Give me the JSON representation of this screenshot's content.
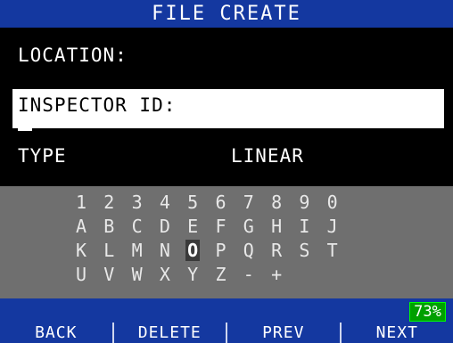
{
  "header": {
    "title": "FILE CREATE"
  },
  "fields": {
    "location_label": "LOCATION:",
    "inspector_label": "INSPECTOR ID:",
    "type_label": "TYPE",
    "type_value": "LINEAR"
  },
  "keyboard": {
    "rows": [
      [
        "1",
        "2",
        "3",
        "4",
        "5",
        "6",
        "7",
        "8",
        "9",
        "0"
      ],
      [
        "A",
        "B",
        "C",
        "D",
        "E",
        "F",
        "G",
        "H",
        "I",
        "J"
      ],
      [
        "K",
        "L",
        "M",
        "N",
        "O",
        "P",
        "Q",
        "R",
        "S",
        "T"
      ],
      [
        "U",
        "V",
        "W",
        "X",
        "Y",
        "Z",
        "-",
        "+"
      ]
    ],
    "selected": "O"
  },
  "status": {
    "battery": "73%"
  },
  "softkeys": [
    "BACK",
    "DELETE",
    "PREV",
    "NEXT"
  ],
  "colors": {
    "title_bg": "#1438a0",
    "keyboard_bg": "#6f6f6f",
    "battery": "#00a000"
  }
}
